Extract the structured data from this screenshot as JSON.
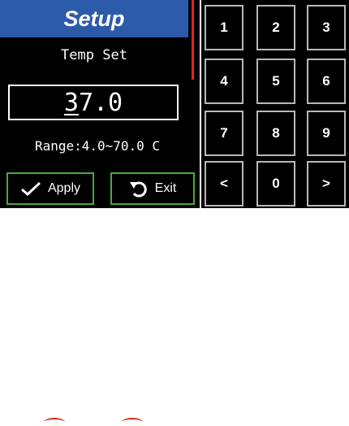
{
  "header": {
    "title": "Setup"
  },
  "form": {
    "label": "Temp Set",
    "value_first_digit": "3",
    "value_rest": "7.0",
    "range": "Range:4.0~70.0 C"
  },
  "buttons": {
    "apply": "Apply",
    "exit": "Exit"
  },
  "keypad": {
    "keys": [
      "1",
      "2",
      "3",
      "4",
      "5",
      "6",
      "7",
      "8",
      "9",
      "<",
      "0",
      ">"
    ]
  },
  "colors": {
    "title_bar": "#2b5aa8",
    "button_border": "#49a93c",
    "accent_line": "#e0261b"
  },
  "icons": {
    "apply": "checkmark-icon",
    "exit": "undo-arrow-icon"
  }
}
